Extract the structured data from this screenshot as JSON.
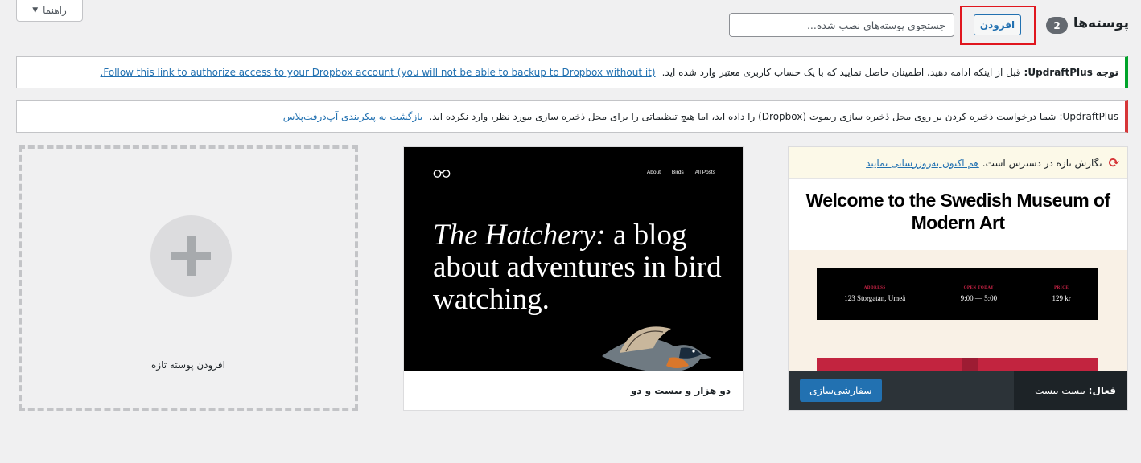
{
  "header": {
    "title": "پوسته‌ها",
    "count": "2",
    "add_label": "افزودن",
    "search_placeholder": "جستجوی پوسته‌های نصب شده...",
    "help_label": "راهنما"
  },
  "notices": {
    "dropbox_auth": {
      "label": "توجه UpdraftPlus:",
      "text": "قبل از اینکه ادامه دهید، اطمینان حاصل نمایید که با یک حساب کاربری معتبر وارد شده اید.",
      "link": "Follow this link to authorize access to your Dropbox account (you will not be able to backup to Dropbox without it)."
    },
    "remote_storage": {
      "label": "UpdraftPlus:",
      "text": "شما درخواست ذخیره کردن بر روی محل ذخیره سازی ریموت (Dropbox) را داده اید، اما هیچ تنظیماتی را برای محل ذخیره سازی مورد نظر، وارد نکرده اید.",
      "link": "بازگشت به پیکربندی آپ‌درفت‌پلاس"
    }
  },
  "themes": {
    "active": {
      "update_text": "نگارش تازه در دسترس است.",
      "update_link": "هم اکنون به‌روزرسانی نمایید",
      "screenshot_title": "Welcome to the Swedish Museum of Modern Art",
      "info": [
        {
          "label": "ADDRESS",
          "value": "123 Storgatan, Umeå"
        },
        {
          "label": "OPEN TODAY",
          "value": "9:00 — 5:00"
        },
        {
          "label": "PRICE",
          "value": "129 kr"
        }
      ],
      "active_prefix": "فعال:",
      "active_name": "بیست بیست",
      "customize_label": "سفارشی‌سازی"
    },
    "second": {
      "nav": [
        "About",
        "Birds",
        "All Posts"
      ],
      "headline_italic": "The Hatchery:",
      "headline_rest": "a blog about adventures in bird watching.",
      "name": "دو هزار و بیست و دو"
    },
    "add_new_label": "افزودن پوسته تازه"
  },
  "colors": {
    "accent": "#2271b1",
    "success": "#00a32a",
    "error": "#d63638",
    "highlight_box": "#e0161e"
  }
}
